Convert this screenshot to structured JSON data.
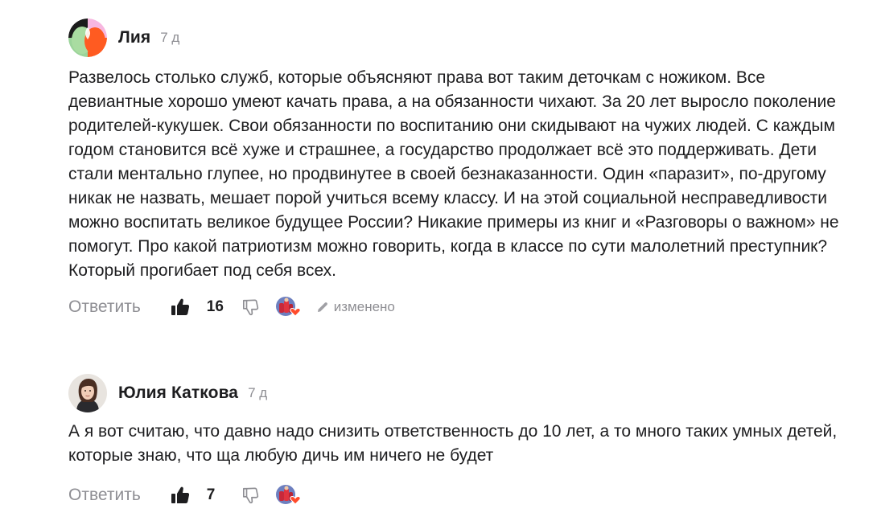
{
  "comments": [
    {
      "author": "Лия",
      "age": "7 д",
      "avatar_icon": "multicolor-blob-avatar",
      "text": "Развелось столько служб, которые объясняют права вот таким деточкам с ножиком. Все девиантные хорошо умеют качать права, а на обязанности чихают. За 20 лет выросло поколение родителей-кукушек. Свои обязанности по воспитанию они скидывают на чужих людей. С каждым годом становится всё хуже и страшнее, а государство продолжает всё это поддерживать. Дети стали ментально глупее, но продвинутее в своей безнаказанности. Один «паразит», по-другому никак не назвать, мешает порой учиться всему классу. И на этой социальной несправедливости можно воспитать великое будущее России? Никакие примеры из книг и «Разговоры о важном» не помогут. Про какой патриотизм можно говорить, когда в классе по сути малолетний преступник? Который прогибает под себя всех.",
      "reply_label": "Ответить",
      "likes": "16",
      "edited_label": "изменено"
    },
    {
      "author": "Юлия Каткова",
      "age": "7 д",
      "avatar_icon": "user-photo-avatar",
      "text": "А я вот считаю, что давно надо снизить ответственность до 10 лет, а то много таких умных детей, которые знаю, что ща любую дичь им ничего не будет",
      "reply_label": "Ответить",
      "likes": "7"
    }
  ],
  "icons": {
    "like": "thumbs-up-filled-icon",
    "dislike": "thumbs-down-outline-icon",
    "reaction": "author-heart-reaction-icon",
    "edit": "pencil-icon"
  },
  "colors": {
    "text": "#1d1d1f",
    "muted": "#8e8e93",
    "heart": "#ff4b2b"
  }
}
